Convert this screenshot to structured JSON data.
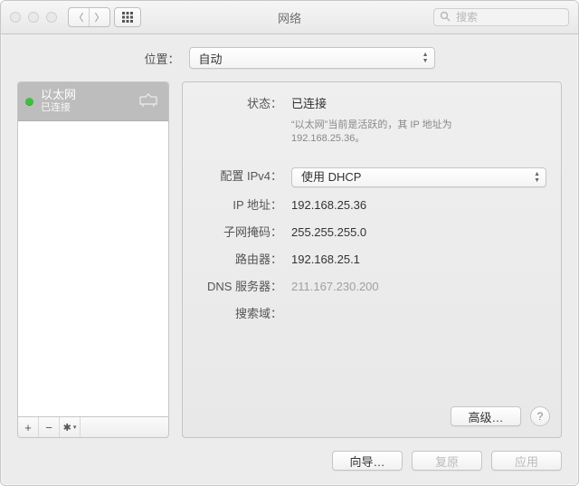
{
  "window": {
    "title": "网络",
    "search_placeholder": "搜索"
  },
  "location": {
    "label": "位置：",
    "value": "自动"
  },
  "sidebar": {
    "items": [
      {
        "name": "以太网",
        "status": "已连接",
        "status_color": "#3fbf3f"
      }
    ],
    "toolbar": {
      "add": "+",
      "remove": "−",
      "action": "✱"
    }
  },
  "detail": {
    "status": {
      "label": "状态：",
      "value": "已连接",
      "description_1": "“以太网”当前是活跃的，其 IP 地址为",
      "description_2": "192.168.25.36。"
    },
    "config_ipv4": {
      "label": "配置 IPv4：",
      "value": "使用 DHCP"
    },
    "ip_address": {
      "label": "IP 地址：",
      "value": "192.168.25.36"
    },
    "subnet_mask": {
      "label": "子网掩码：",
      "value": "255.255.255.0"
    },
    "router": {
      "label": "路由器：",
      "value": "192.168.25.1"
    },
    "dns": {
      "label": "DNS 服务器：",
      "value": "211.167.230.200"
    },
    "search_domain": {
      "label": "搜索域：",
      "value": ""
    },
    "advanced_label": "高级…",
    "help_label": "?"
  },
  "footer": {
    "assistant": "向导…",
    "revert": "复原",
    "apply": "应用"
  }
}
